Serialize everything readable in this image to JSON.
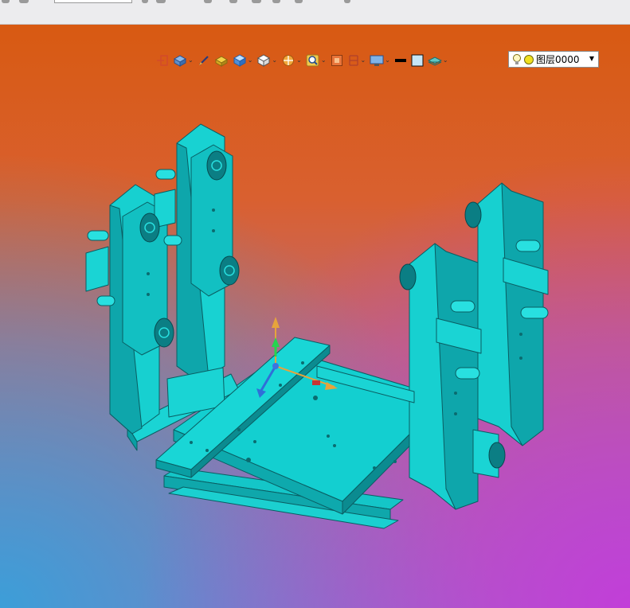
{
  "layer_selector": {
    "value": "图层0000"
  },
  "icons": [
    "exit-sketch-icon",
    "display-mode-icon",
    "pen-icon",
    "shade-icon",
    "cube-blue-icon",
    "cube-white-icon",
    "section-icon",
    "zoom-icon",
    "frame-icon",
    "bracket-icon",
    "monitor-icon",
    "line-color-icon",
    "fill-color-icon",
    "layer-stack-icon",
    "light-bulb-icon",
    "layer-status-icon"
  ],
  "colors": {
    "model": "#17d3d3",
    "model_dark": "#0b6e73",
    "viewport_top": "#d85a12",
    "viewport_bottom_left": "#3c9ed8",
    "viewport_bottom_right": "#c23ed8"
  }
}
